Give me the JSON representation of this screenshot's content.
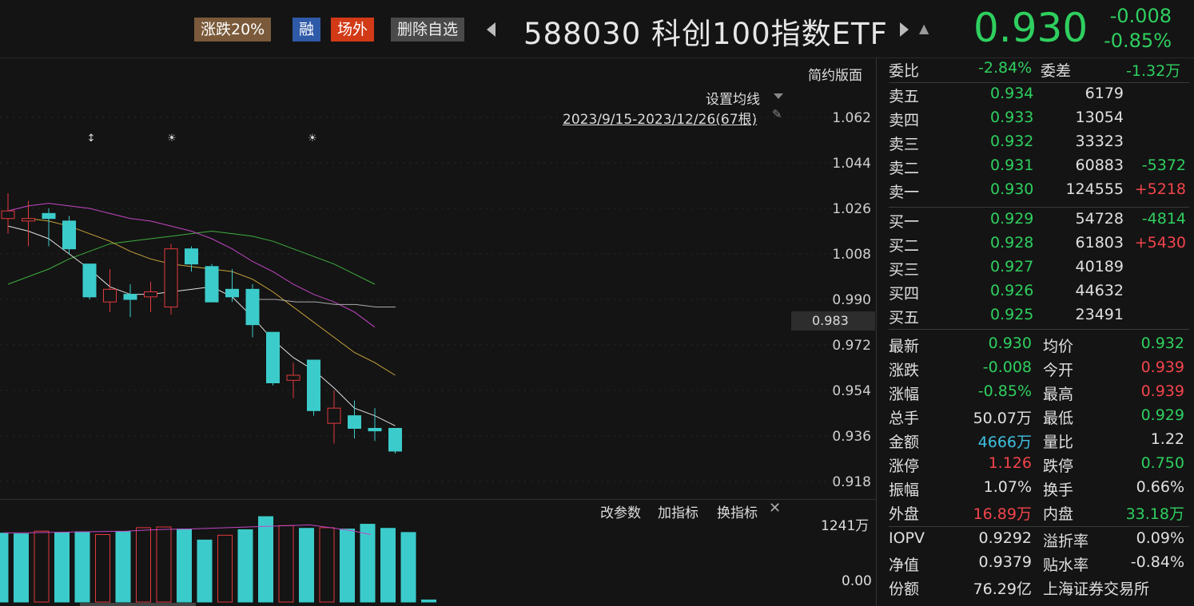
{
  "header": {
    "tags": [
      "涨跌20%",
      "融",
      "场外",
      "删除自选"
    ],
    "code": "588030",
    "name": "科创100指数ETF",
    "price": "0.930",
    "change": "-0.008",
    "change_pct": "-0.85%"
  },
  "chart": {
    "version_btn": "简约版面",
    "set_ma": "设置均线",
    "range": "2023/9/15-2023/12/26(67根)",
    "price_ticks": [
      "1.062",
      "1.044",
      "1.026",
      "1.008",
      "0.990",
      "0.972",
      "0.954",
      "0.936",
      "0.918"
    ],
    "cursor_label": "0.983",
    "indicator_btns": [
      "改参数",
      "加指标",
      "换指标"
    ],
    "vol_top": "1241万",
    "vol_bottom": "0.00"
  },
  "chart_data": {
    "type": "candlestick",
    "y_range": [
      0.912,
      1.068
    ],
    "candles": [
      {
        "o": 1.022,
        "c": 1.025,
        "h": 1.032,
        "l": 1.016
      },
      {
        "o": 1.021,
        "c": 1.022,
        "h": 1.029,
        "l": 1.011
      },
      {
        "o": 1.024,
        "c": 1.022,
        "h": 1.026,
        "l": 1.011
      },
      {
        "o": 1.021,
        "c": 1.01,
        "h": 1.023,
        "l": 1.008
      },
      {
        "o": 1.004,
        "c": 0.991,
        "h": 1.004,
        "l": 0.99
      },
      {
        "o": 0.989,
        "c": 0.994,
        "h": 1.002,
        "l": 0.985
      },
      {
        "o": 0.992,
        "c": 0.99,
        "h": 0.996,
        "l": 0.983
      },
      {
        "o": 0.991,
        "c": 0.993,
        "h": 0.997,
        "l": 0.985
      },
      {
        "o": 0.987,
        "c": 1.01,
        "h": 1.012,
        "l": 0.984
      },
      {
        "o": 1.01,
        "c": 1.004,
        "h": 1.011,
        "l": 1.001
      },
      {
        "o": 1.003,
        "c": 0.989,
        "h": 1.004,
        "l": 0.989
      },
      {
        "o": 0.994,
        "c": 0.991,
        "h": 1.002,
        "l": 0.989
      },
      {
        "o": 0.994,
        "c": 0.98,
        "h": 0.996,
        "l": 0.975
      },
      {
        "o": 0.977,
        "c": 0.957,
        "h": 0.977,
        "l": 0.956
      },
      {
        "o": 0.958,
        "c": 0.96,
        "h": 0.965,
        "l": 0.951
      },
      {
        "o": 0.966,
        "c": 0.946,
        "h": 0.966,
        "l": 0.944
      },
      {
        "o": 0.941,
        "c": 0.947,
        "h": 0.954,
        "l": 0.933
      },
      {
        "o": 0.944,
        "c": 0.939,
        "h": 0.95,
        "l": 0.935
      },
      {
        "o": 0.939,
        "c": 0.938,
        "h": 0.947,
        "l": 0.934
      },
      {
        "o": 0.939,
        "c": 0.93,
        "h": 0.939,
        "l": 0.929
      }
    ],
    "volume_max_wan": 1241,
    "volumes_wan": [
      1000,
      990,
      1030,
      1010,
      1020,
      980,
      1020,
      1080,
      1090,
      1060,
      900,
      970,
      1050,
      1240,
      1110,
      1070,
      1080,
      1060,
      1130,
      1070,
      1010,
      30
    ],
    "ma_white": [
      1.019,
      1.017,
      1.014,
      1.008,
      1.002,
      0.995,
      0.992,
      0.992,
      0.993,
      0.994,
      0.995,
      0.991,
      0.983,
      0.974,
      0.967,
      0.962,
      0.955,
      0.947,
      0.944,
      0.94
    ],
    "ma_yellow": [
      1.022,
      1.021,
      1.019,
      1.016,
      1.013,
      1.009,
      1.006,
      1.004,
      1.003,
      1.002,
      1.001,
      0.998,
      0.993,
      0.987,
      0.981,
      0.975,
      0.969,
      0.965,
      0.96
    ],
    "ma_pink": [
      1.025,
      1.027,
      1.028,
      1.027,
      1.026,
      1.024,
      1.022,
      1.021,
      1.019,
      1.017,
      1.014,
      1.01,
      1.005,
      1.001,
      0.996,
      0.992,
      0.989,
      0.985,
      0.979
    ],
    "ma_green": [
      0.996,
      0.999,
      1.002,
      1.006,
      1.009,
      1.012,
      1.013,
      1.014,
      1.015,
      1.016,
      1.017,
      1.016,
      1.015,
      1.013,
      1.01,
      1.007,
      1.004,
      1.0,
      0.996
    ],
    "ma_gray": [
      0.99,
      0.99,
      0.989,
      0.989,
      0.988,
      0.988,
      0.987,
      0.987
    ],
    "markers": [
      "↕",
      "☀",
      "☀"
    ]
  },
  "panel": {
    "weibi_label": "委比",
    "weibi": "-2.84%",
    "weicha_label": "委差",
    "weicha": "-1.32万",
    "asks": [
      {
        "label": "卖五",
        "price": "0.934",
        "vol": "6179",
        "diff": ""
      },
      {
        "label": "卖四",
        "price": "0.933",
        "vol": "13054",
        "diff": ""
      },
      {
        "label": "卖三",
        "price": "0.932",
        "vol": "33323",
        "diff": ""
      },
      {
        "label": "卖二",
        "price": "0.931",
        "vol": "60883",
        "diff": "-5372"
      },
      {
        "label": "卖一",
        "price": "0.930",
        "vol": "124555",
        "diff": "+5218"
      }
    ],
    "bids": [
      {
        "label": "买一",
        "price": "0.929",
        "vol": "54728",
        "diff": "-4814"
      },
      {
        "label": "买二",
        "price": "0.928",
        "vol": "61803",
        "diff": "+5430"
      },
      {
        "label": "买三",
        "price": "0.927",
        "vol": "40189",
        "diff": ""
      },
      {
        "label": "买四",
        "price": "0.926",
        "vol": "44632",
        "diff": ""
      },
      {
        "label": "买五",
        "price": "0.925",
        "vol": "23491",
        "diff": ""
      }
    ],
    "stats": [
      {
        "l1": "最新",
        "v1": "0.930",
        "l2": "均价",
        "v2": "0.932"
      },
      {
        "l1": "涨跌",
        "v1": "-0.008",
        "l2": "今开",
        "v2": "0.939"
      },
      {
        "l1": "涨幅",
        "v1": "-0.85%",
        "l2": "最高",
        "v2": "0.939"
      },
      {
        "l1": "总手",
        "v1": "50.07万",
        "l2": "最低",
        "v2": "0.929"
      },
      {
        "l1": "金额",
        "v1": "4666万",
        "l2": "量比",
        "v2": "1.22"
      },
      {
        "l1": "涨停",
        "v1": "1.126",
        "l2": "跌停",
        "v2": "0.750"
      },
      {
        "l1": "振幅",
        "v1": "1.07%",
        "l2": "换手",
        "v2": "0.66%"
      },
      {
        "l1": "外盘",
        "v1": "16.89万",
        "l2": "内盘",
        "v2": "33.18万"
      }
    ],
    "stats2": [
      {
        "l1": "IOPV",
        "v1": "0.9292",
        "l2": "溢折率",
        "v2": "0.09%"
      },
      {
        "l1": "净值",
        "v1": "0.9379",
        "l2": "贴水率",
        "v2": "-0.84%"
      },
      {
        "l1": "份额",
        "v1": "76.29亿",
        "l2": "上海证券交易所",
        "v2": ""
      }
    ]
  }
}
